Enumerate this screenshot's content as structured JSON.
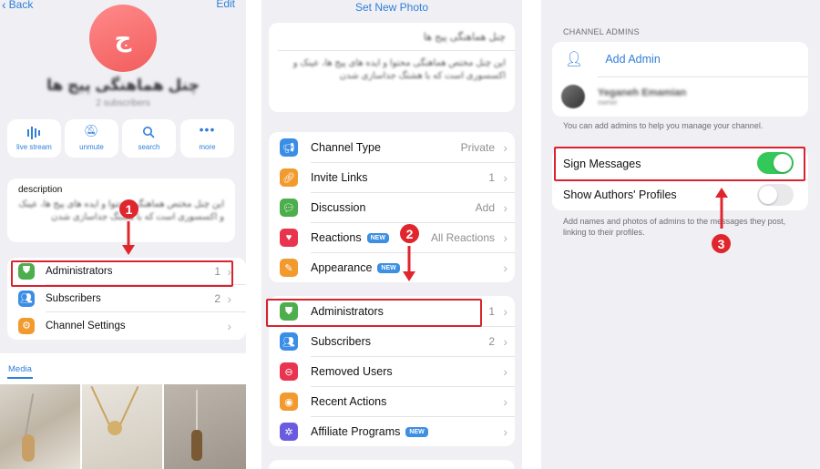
{
  "panel1": {
    "back_label": "Back",
    "edit_label": "Edit",
    "avatar_letter": "ج",
    "channel_name": "چنل هماهنگی پیج ها",
    "subscribers_count": "2 subscribers",
    "actions": [
      {
        "label": "live stream",
        "icon": "waveform-icon"
      },
      {
        "label": "unmute",
        "icon": "bell-slash-icon"
      },
      {
        "label": "search",
        "icon": "search-icon"
      },
      {
        "label": "more",
        "icon": "more-icon"
      }
    ],
    "description_label": "description",
    "description_text": "این چنل مختص هماهنگی محتوا و ایده های پیج ها، عینک و اکسسوری است که با هشتگ جداسازی شدن",
    "rows": [
      {
        "label": "Administrators",
        "value": "1",
        "icon": "shield-icon",
        "color": "#4cae4c"
      },
      {
        "label": "Subscribers",
        "value": "2",
        "icon": "people-icon",
        "color": "#3a8ee6"
      },
      {
        "label": "Channel Settings",
        "value": "",
        "icon": "sliders-icon",
        "color": "#f29a2e"
      }
    ],
    "media_tab": "Media"
  },
  "panel2": {
    "set_photo": "Set New Photo",
    "name_field": "چنل هماهنگی پیج ها",
    "description_field": "این چنل مختص هماهنگی محتوا و ایده های پیج ها، عینک و اکسسوری است که با هشتگ جداسازی شدن",
    "group1": [
      {
        "label": "Channel Type",
        "value": "Private",
        "icon": "megaphone-icon",
        "color": "#3a8ee6",
        "new": false
      },
      {
        "label": "Invite Links",
        "value": "1",
        "icon": "link-icon",
        "color": "#f29a2e",
        "new": false
      },
      {
        "label": "Discussion",
        "value": "Add",
        "icon": "chat-bubble-icon",
        "color": "#4cae4c",
        "new": false
      },
      {
        "label": "Reactions",
        "value": "All Reactions",
        "icon": "heart-icon",
        "color": "#e8344e",
        "new": true
      },
      {
        "label": "Appearance",
        "value": "",
        "icon": "brush-icon",
        "color": "#f29a2e",
        "new": true
      }
    ],
    "group2": [
      {
        "label": "Administrators",
        "value": "1",
        "icon": "shield-icon",
        "color": "#4cae4c",
        "new": false
      },
      {
        "label": "Subscribers",
        "value": "2",
        "icon": "people-icon",
        "color": "#3a8ee6",
        "new": false
      },
      {
        "label": "Removed Users",
        "value": "",
        "icon": "minus-circle-icon",
        "color": "#e8344e",
        "new": false
      },
      {
        "label": "Recent Actions",
        "value": "",
        "icon": "eye-icon",
        "color": "#f29a2e",
        "new": false
      },
      {
        "label": "Affiliate Programs",
        "value": "",
        "icon": "affiliate-icon",
        "color": "#6b5be0",
        "new": true
      }
    ],
    "new_tag": "NEW"
  },
  "panel3": {
    "section_title": "CHANNEL ADMINS",
    "add_admin": "Add Admin",
    "admin_name": "Yeganeh Emamian",
    "admin_role": "owner",
    "admins_hint": "You can add admins to help you manage your channel.",
    "sign_messages": "Sign Messages",
    "sign_messages_on": true,
    "show_profiles": "Show Authors' Profiles",
    "show_profiles_on": false,
    "sign_hint": "Add names and photos of admins to the messages they post, linking to their profiles."
  },
  "steps": [
    "1",
    "2",
    "3"
  ],
  "colors": {
    "accent": "#2f7fd8",
    "highlight": "#d9232f",
    "toggle_on": "#34c759",
    "background": "#efeff4"
  }
}
